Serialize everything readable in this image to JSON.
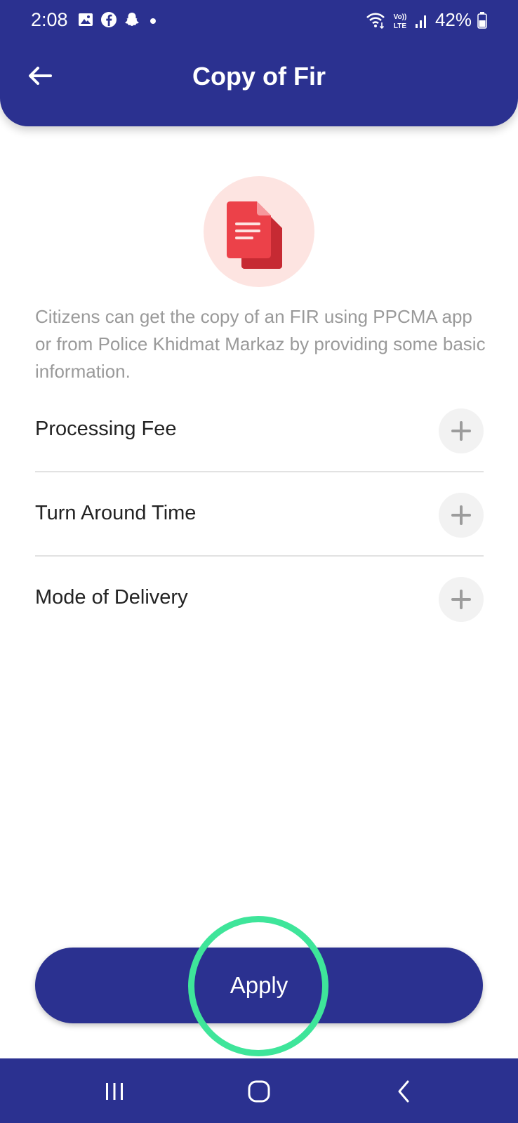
{
  "status_bar": {
    "time": "2:08",
    "battery": "42%",
    "network": "Vo)) LTE",
    "left_icons": [
      "gallery-icon",
      "facebook-icon",
      "snapchat-icon",
      "dot-icon"
    ],
    "right_icons": [
      "wifi-icon",
      "volte-icon",
      "signal-icon",
      "battery-icon"
    ]
  },
  "header": {
    "title": "Copy of Fir",
    "back_icon": "arrow-left-icon"
  },
  "illustration": {
    "icon": "document-icon"
  },
  "description": "Citizens can get the copy of an FIR using PPCMA app or from Police Khidmat Markaz by providing some basic information.",
  "sections": [
    {
      "label": "Processing Fee",
      "icon": "plus-icon"
    },
    {
      "label": "Turn Around Time",
      "icon": "plus-icon"
    },
    {
      "label": "Mode of Delivery",
      "icon": "plus-icon"
    }
  ],
  "apply_button": {
    "label": "Apply"
  },
  "nav_bar": {
    "icons": [
      "recent-apps-icon",
      "home-icon",
      "back-icon"
    ]
  },
  "colors": {
    "primary": "#2b3190",
    "highlight": "#3ee59a",
    "icon_red": "#e53d45",
    "icon_bg": "#fde4e1"
  }
}
